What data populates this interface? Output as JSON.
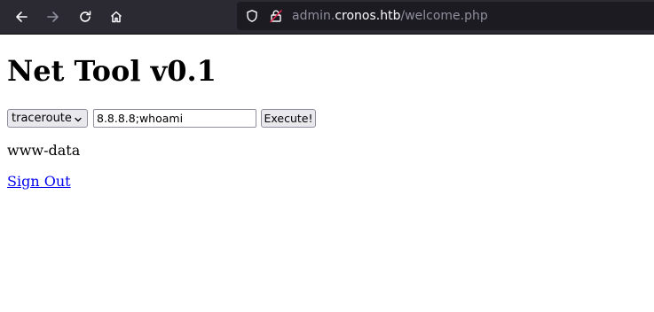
{
  "browser": {
    "nav_icons": [
      "back-arrow-icon",
      "forward-arrow-icon",
      "reload-icon",
      "home-icon"
    ],
    "address_bar": {
      "subdomain": "admin.",
      "domain": "cronos.htb",
      "path": "/welcome.php"
    },
    "colors": {
      "toolbar_bg": "#2b2a33",
      "urlbar_bg": "#1c1b22",
      "url_dim": "#8f8f9d",
      "url_bright": "#fbfbfe"
    }
  },
  "page": {
    "title": "Net Tool v0.1",
    "form": {
      "command_select": "traceroute",
      "host_value": "8.8.8.8;whoami",
      "submit_label": "Execute!"
    },
    "output": "www-data",
    "signout_label": "Sign Out",
    "colors": {
      "link": "#0000ee"
    }
  }
}
